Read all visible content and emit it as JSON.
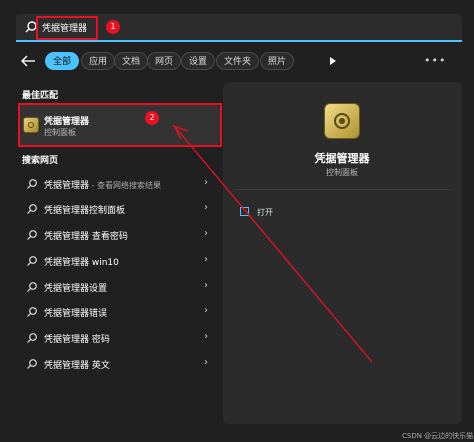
{
  "search": {
    "value": "凭据管理器"
  },
  "annotations": {
    "badge1": "1",
    "badge2": "2"
  },
  "filters": [
    "全部",
    "应用",
    "文档",
    "网页",
    "设置",
    "文件夹",
    "照片"
  ],
  "best_match": {
    "section_title": "最佳匹配",
    "name": "凭据管理器",
    "subtitle": "控制面板"
  },
  "web_search": {
    "section_title": "搜索网页",
    "items": [
      {
        "main": "凭据管理器",
        "suffix": " - 查看网络搜索结果"
      },
      {
        "main": "凭据管理器控制面板",
        "suffix": ""
      },
      {
        "main": "凭据管理器 查看密码",
        "suffix": ""
      },
      {
        "main": "凭据管理器 win10",
        "suffix": ""
      },
      {
        "main": "凭据管理器设置",
        "suffix": ""
      },
      {
        "main": "凭据管理器错误",
        "suffix": ""
      },
      {
        "main": "凭据管理器 密码",
        "suffix": ""
      },
      {
        "main": "凭据管理器 英文",
        "suffix": ""
      }
    ]
  },
  "detail": {
    "title": "凭据管理器",
    "subtitle": "控制面板",
    "actions": [
      {
        "label": "打开"
      }
    ]
  },
  "watermark": "CSDN @云边的快乐猫",
  "colors": {
    "accent": "#4cc2ff",
    "annotation": "#e81123",
    "background": "#202020"
  }
}
